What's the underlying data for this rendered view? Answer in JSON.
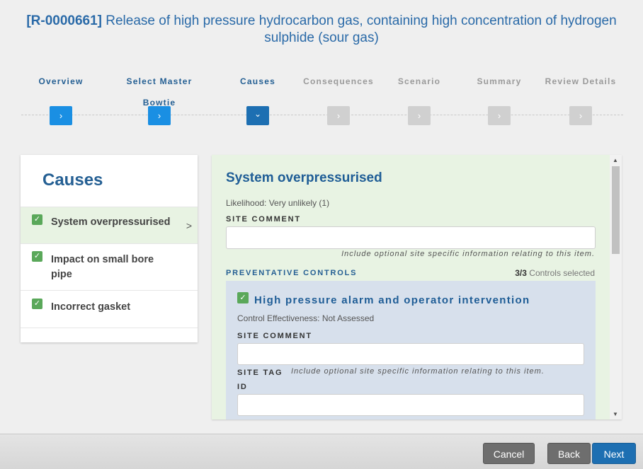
{
  "header": {
    "ref": "[R-0000661]",
    "title": "Release of high pressure hydrocarbon gas, containing high concentration of hydrogen sulphide (sour gas)"
  },
  "steps": [
    {
      "label": "Overview",
      "state": "done",
      "icon": "chevron-right-icon",
      "glyph": "›"
    },
    {
      "label": "Select Master Bowtie",
      "state": "done",
      "icon": "chevron-right-icon",
      "glyph": "›"
    },
    {
      "label": "Causes",
      "state": "current",
      "icon": "chevron-down-icon",
      "glyph": "⌄"
    },
    {
      "label": "Consequences",
      "state": "future",
      "icon": "chevron-right-icon",
      "glyph": "›"
    },
    {
      "label": "Scenario",
      "state": "future",
      "icon": "chevron-right-icon",
      "glyph": "›"
    },
    {
      "label": "Summary",
      "state": "future",
      "icon": "chevron-right-icon",
      "glyph": "›"
    },
    {
      "label": "Review Details",
      "state": "future",
      "icon": "chevron-right-icon",
      "glyph": "›"
    }
  ],
  "causes": {
    "title": "Causes",
    "items": [
      {
        "label": "System overpressurised",
        "checked": true,
        "active": true
      },
      {
        "label": "Impact on small bore pipe",
        "checked": true,
        "active": false
      },
      {
        "label": "Incorrect gasket",
        "checked": true,
        "active": false
      }
    ]
  },
  "detail": {
    "title": "System overpressurised",
    "likelihood": "Likelihood: Very unlikely (1)",
    "site_comment_label": "SITE COMMENT",
    "site_comment_value": "",
    "site_comment_hint": "Include optional site specific information relating to this item.",
    "preventative_label": "PREVENTATIVE CONTROLS",
    "controls_selected": "3/3",
    "controls_selected_suffix": "Controls selected",
    "control": {
      "title": "High pressure alarm and operator intervention",
      "checked": true,
      "effectiveness": "Control Effectiveness: Not Assessed",
      "site_comment_label": "SITE COMMENT",
      "site_comment_value": "",
      "site_comment_hint": "Include optional site specific information relating to this item.",
      "site_tag_label": "SITE TAG",
      "id_label": "ID",
      "id_value": ""
    }
  },
  "footer": {
    "cancel": "Cancel",
    "back": "Back",
    "next": "Next"
  },
  "colors": {
    "accent": "#1d6fb2",
    "done_step": "#1a8fe3",
    "future_step": "#d0d0d0",
    "check": "#5aa85a",
    "active_row": "#e8f3e3",
    "control_card": "#d7e0ec"
  }
}
